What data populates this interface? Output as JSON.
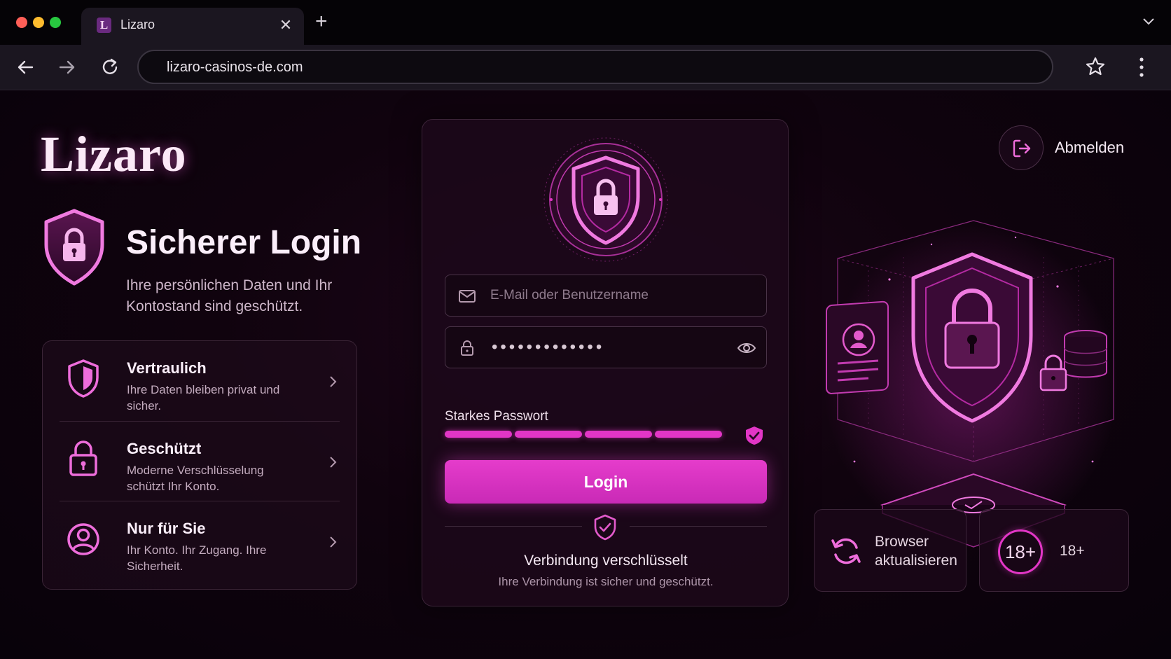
{
  "browser": {
    "tab_title": "Lizaro",
    "tab_favicon_letter": "L",
    "url": "lizaro-casinos-de.com",
    "colors": {
      "close_red": "#ff5f57",
      "minimize_yellow": "#febc2e",
      "zoom_green": "#28c840"
    }
  },
  "brand": {
    "logo": "Lizaro",
    "accent": "#e236c6"
  },
  "hero": {
    "title": "Sicherer Login",
    "subtitle": "Ihre persönlichen Daten und Ihr Kontostand sind geschützt."
  },
  "features": [
    {
      "icon": "shield-icon",
      "title": "Vertraulich",
      "desc": "Ihre Daten bleiben privat und sicher."
    },
    {
      "icon": "lock-icon",
      "title": "Geschützt",
      "desc": "Moderne Verschlüsselung schützt Ihr Konto."
    },
    {
      "icon": "user-icon",
      "title": "Nur für Sie",
      "desc": "Ihr Konto. Ihr Zugang. Ihre Sicherheit."
    }
  ],
  "login": {
    "email_placeholder": "E-Mail oder Benutzername",
    "password_masked": "•••••••••••••",
    "strength_label": "Starkes Passwort",
    "strength_segments_filled": 4,
    "strength_segments_total": 4,
    "button_label": "Login",
    "encryption_title": "Verbindung verschlüsselt",
    "encryption_subtitle": "Ihre Verbindung ist sicher und geschützt."
  },
  "header": {
    "logout_label": "Abmelden"
  },
  "tiles": {
    "browser_update": "Browser aktualisieren",
    "age_badge": "18+",
    "age_label": "18+"
  }
}
